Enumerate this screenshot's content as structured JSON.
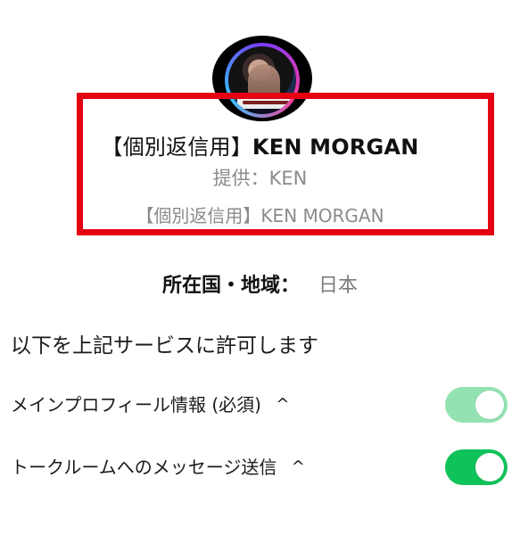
{
  "profile": {
    "title_prefix": "【個別返信用】",
    "title_name": "KEN MORGAN",
    "provider": "提供：KEN",
    "subtitle": "【個別返信用】KEN MORGAN"
  },
  "region": {
    "label": "所在国・地域：",
    "value": "日本"
  },
  "permissions": {
    "heading": "以下を上記サービスに許可します",
    "items": [
      {
        "label": "メインプロフィール情報 (必須)",
        "chevron": "^",
        "toggle_state": "on (disabled)"
      },
      {
        "label": "トークルームへのメッセージ送信",
        "chevron": "^",
        "toggle_state": "on"
      }
    ]
  },
  "colors": {
    "highlight_red": "#e50012",
    "toggle_green": "#10c25a",
    "toggle_green_light": "#93e2b1"
  },
  "icons": {
    "avatar": "avatar",
    "chevron": "chevron-up-icon"
  }
}
